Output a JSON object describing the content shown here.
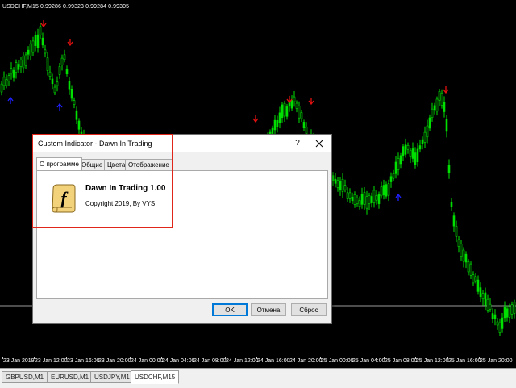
{
  "chart": {
    "symbol_header": "USDCHF,M15  0.99286 0.99323 0.99284 0.99305",
    "bull_color": "#00e000",
    "down_arrow_color": "#e01010",
    "up_arrow_color": "#2020ff",
    "time_labels": [
      "23 Jan 2019",
      "23 Jan 12:00",
      "23 Jan 16:00",
      "23 Jan 20:00",
      "24 Jan 00:00",
      "24 Jan 04:00",
      "24 Jan 08:00",
      "24 Jan 12:00",
      "24 Jan 16:00",
      "24 Jan 20:00",
      "25 Jan 00:00",
      "25 Jan 04:00",
      "25 Jan 08:00",
      "25 Jan 12:00",
      "25 Jan 16:00",
      "25 Jan 20:00"
    ]
  },
  "symbol_tabs": [
    {
      "label": "GBPUSD,M1",
      "active": false
    },
    {
      "label": "EURUSD,M1",
      "active": false
    },
    {
      "label": "USDJPY,M1",
      "active": false
    },
    {
      "label": "USDCHF,M15",
      "active": true
    }
  ],
  "dialog": {
    "title": "Custom Indicator - Dawn In Trading",
    "help_label": "?",
    "tabs": [
      "О программе",
      "Общие",
      "Цвета",
      "Отображение"
    ],
    "active_tab": 0,
    "indicator_name": "Dawn In Trading 1.00",
    "copyright": "Copyright 2019, By VYS",
    "icon": "script-f-icon",
    "buttons": {
      "ok": "OK",
      "cancel": "Отмена",
      "reset": "Сброс"
    },
    "highlight_color": "#e0251b"
  }
}
